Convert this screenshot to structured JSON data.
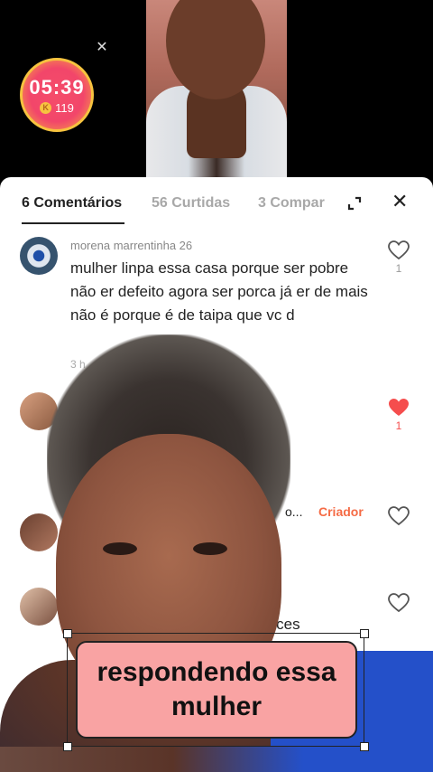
{
  "timer": {
    "time": "05:39",
    "coins": "119",
    "coin_symbol": "K"
  },
  "tabs": [
    {
      "label": "6 Comentários",
      "active": true
    },
    {
      "label": "56 Curtidas",
      "active": false
    },
    {
      "label": "3 Compar",
      "active": false
    }
  ],
  "comments": [
    {
      "user": "morena marrentinha 26",
      "text": "mulher linpa essa casa porque ser pobre não er defeito agora ser porca já er de mais não é porque é de taipa que vc d",
      "time": "3 h",
      "likes": "1",
      "liked": false
    },
    {
      "likes": "1",
      "liked": true
    },
    {
      "dots": "o...",
      "badge": "Criador"
    },
    {
      "text_fragment": "e  voces"
    }
  ],
  "caption": "respondendo essa mulher",
  "colors": {
    "accent_red": "#f54d4d",
    "creator_orange": "#f56b45",
    "caption_bg": "#f9a3a3"
  }
}
